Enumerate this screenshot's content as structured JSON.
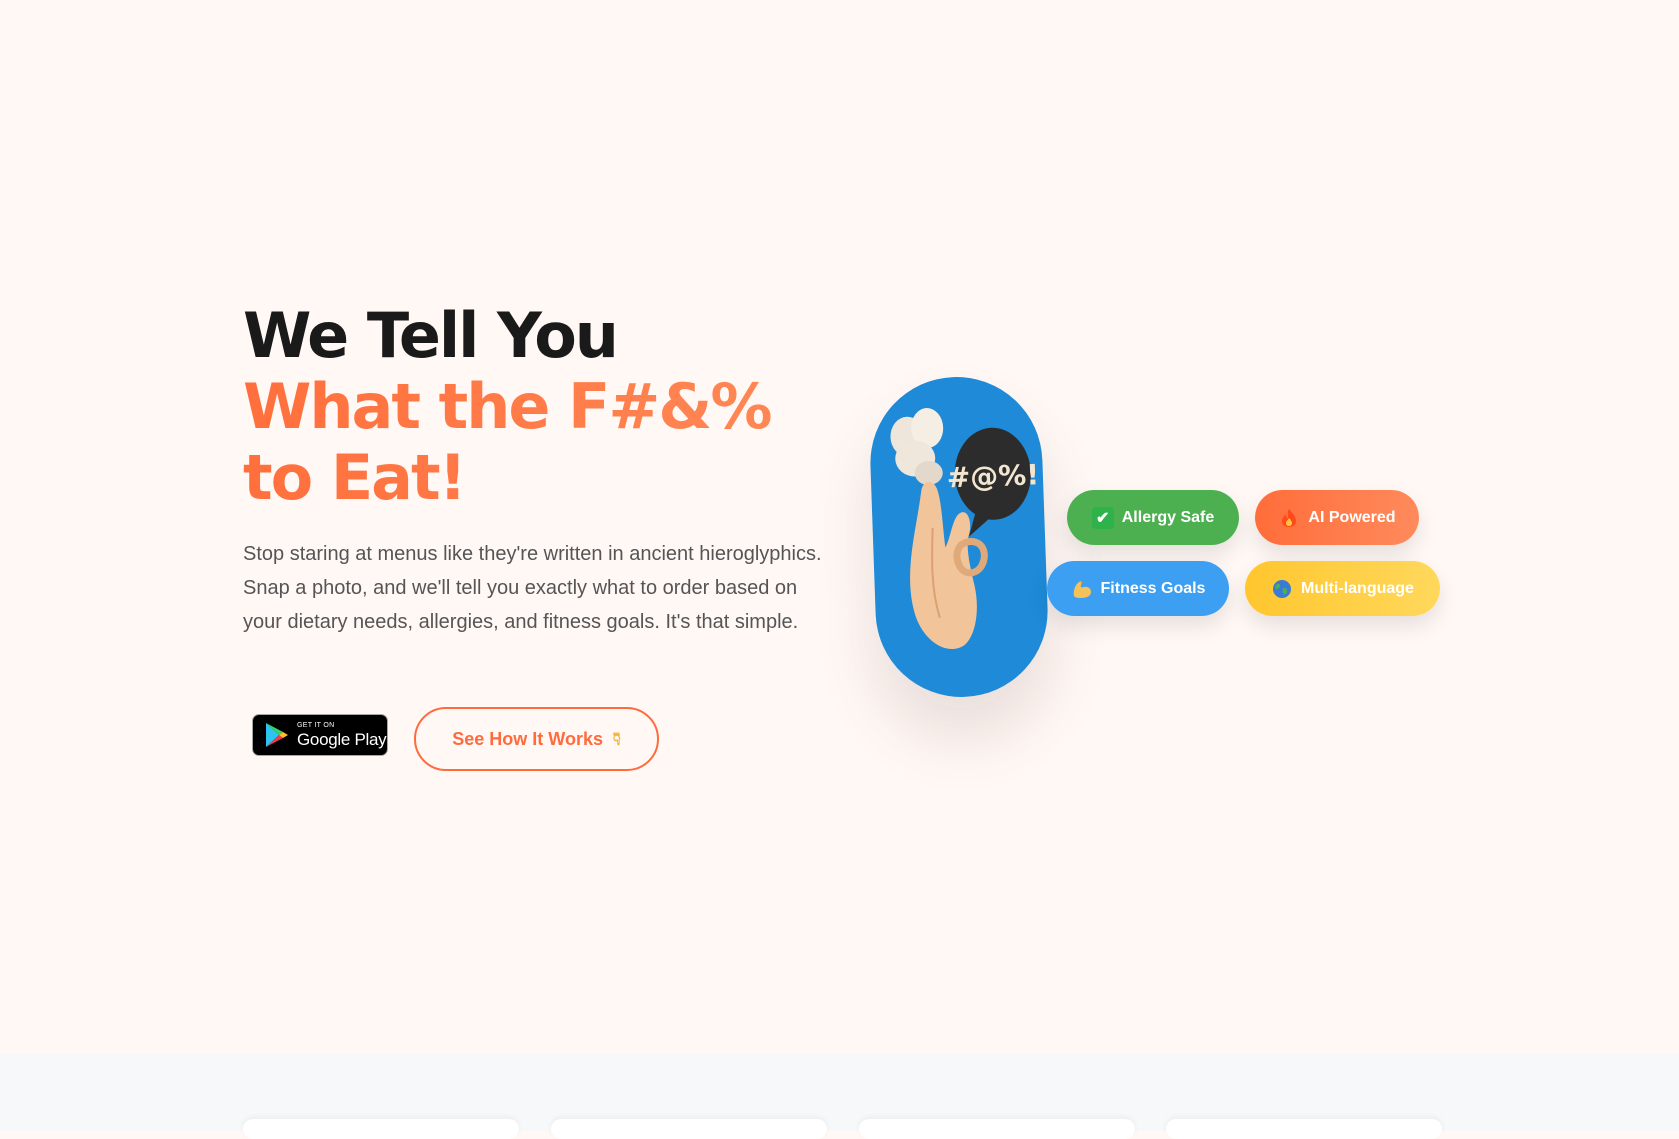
{
  "hero": {
    "title_line1": "We Tell You",
    "title_line2": "What the F#&% to Eat!",
    "subtitle": "Stop staring at menus like they're written in ancient hieroglyphics. Snap a photo, and we'll tell you exactly what to order based on your dietary needs, allergies, and fitness goals. It's that simple.",
    "google_play": {
      "small_label": "GET IT ON",
      "big_label": "Google Play"
    },
    "cta": {
      "label": "See How It Works",
      "icon": "pointing-down-icon"
    }
  },
  "mascot": {
    "speech_bubble_text": "#@%!",
    "icon": "chef-hand-ok-icon"
  },
  "feature_chips": [
    {
      "label": "Allergy Safe",
      "icon": "check-mark-icon",
      "color": "#4cb050"
    },
    {
      "label": "AI Powered",
      "icon": "fire-icon",
      "color": "#ff6d3a"
    },
    {
      "label": "Fitness Goals",
      "icon": "flexed-bicep-icon",
      "color": "#3d9ff2"
    },
    {
      "label": "Multi-language",
      "icon": "globe-icon",
      "color": "#ffc62e"
    }
  ],
  "colors": {
    "background": "#fff8f5",
    "accent": "#ff6b3d",
    "mascot_blue": "#1e8ad8",
    "heading": "#1a1a1a",
    "body_text": "#555555"
  }
}
